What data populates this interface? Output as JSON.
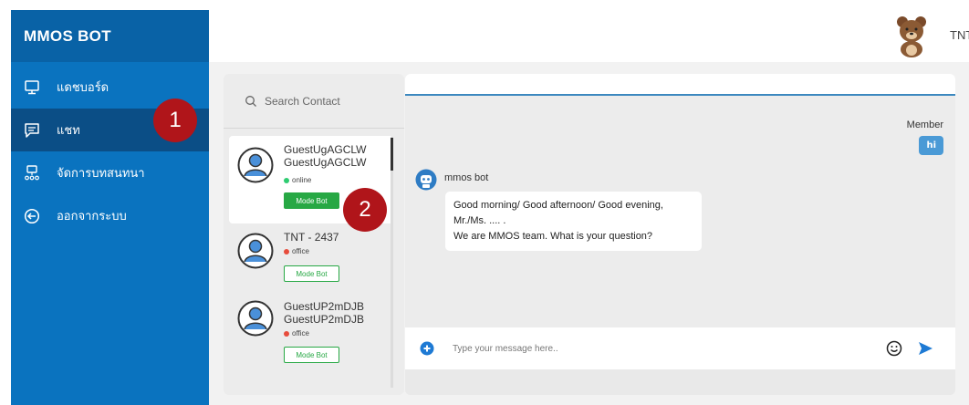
{
  "app": {
    "title": "MMOS BOT"
  },
  "sidebar": {
    "items": [
      {
        "label": "แดชบอร์ด",
        "icon": "monitor-icon",
        "active": false
      },
      {
        "label": "แชท",
        "icon": "chat-icon",
        "active": true
      },
      {
        "label": "จัดการบทสนทนา",
        "icon": "org-chart-icon",
        "active": false
      },
      {
        "label": "ออกจากระบบ",
        "icon": "logout-icon",
        "active": false
      }
    ]
  },
  "header": {
    "user_name": "TNT -"
  },
  "contacts": {
    "search_placeholder": "Search Contact",
    "list": [
      {
        "name": "GuestUgAGCLW GuestUgAGCLW",
        "status": "online",
        "status_color": "#2ecc71",
        "mode_label": "Mode Bot",
        "mode_style": "filled",
        "selected": true
      },
      {
        "name": "TNT - 2437",
        "status": "office",
        "status_color": "#e74c3c",
        "mode_label": "Mode Bot",
        "mode_style": "outline",
        "selected": false
      },
      {
        "name": "GuestUP2mDJB GuestUP2mDJB",
        "status": "office",
        "status_color": "#e74c3c",
        "mode_label": "Mode Bot",
        "mode_style": "outline",
        "selected": false
      }
    ]
  },
  "chat": {
    "member_label": "Member",
    "member_message": "hi",
    "bot_name": "mmos bot",
    "bot_message_lines": [
      "Good morning/ Good afternoon/ Good evening,",
      "Mr./Ms. .... .",
      "We are MMOS team. What is your question?"
    ],
    "input_placeholder": "Type your message here.."
  },
  "annotations": {
    "badge_1": "1",
    "badge_2": "2"
  },
  "colors": {
    "sidebar_bg": "#0a73bf",
    "sidebar_active": "#0b4e86",
    "accent_blue": "#4a9ad6",
    "mode_green": "#27a844",
    "badge_red": "#b0151a"
  }
}
